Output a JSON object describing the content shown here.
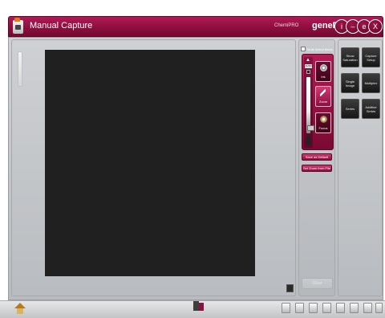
{
  "window": {
    "title": "Manual Capture",
    "brand_small": "ChemiPRO",
    "brand": "genePIX",
    "controls": [
      {
        "name": "info-icon",
        "glyph": "i"
      },
      {
        "name": "minimize-icon",
        "glyph": "–"
      },
      {
        "name": "settings-icon",
        "glyph": "e"
      },
      {
        "name": "close-icon",
        "glyph": "X"
      }
    ]
  },
  "capture_panel": {
    "multi_select_mode": "Multi Select Mode",
    "multi_select_checked": false,
    "auto_label": "AUTO",
    "buttons": {
      "iris": "Iris",
      "zoom": "Zoom",
      "focus": "Focus"
    },
    "save_default": "Save as Default",
    "set_zoom": "Set Zoom from File",
    "clear": "Clear"
  },
  "capture_options": [
    {
      "name": "show-saturation-button",
      "label": "Show Saturation"
    },
    {
      "name": "capture-setup-button",
      "label": "Capture Setup"
    },
    {
      "name": "single-image-button",
      "label": "Single Image"
    },
    {
      "name": "multiplex-button",
      "label": "Multiplex"
    },
    {
      "name": "series-button",
      "label": "Series"
    },
    {
      "name": "additive-series-button",
      "label": "Additive Series"
    }
  ],
  "colors": {
    "accent": "#8d0f3f",
    "preview_bg": "#202020",
    "panel_bg": "#c6c8cb"
  }
}
